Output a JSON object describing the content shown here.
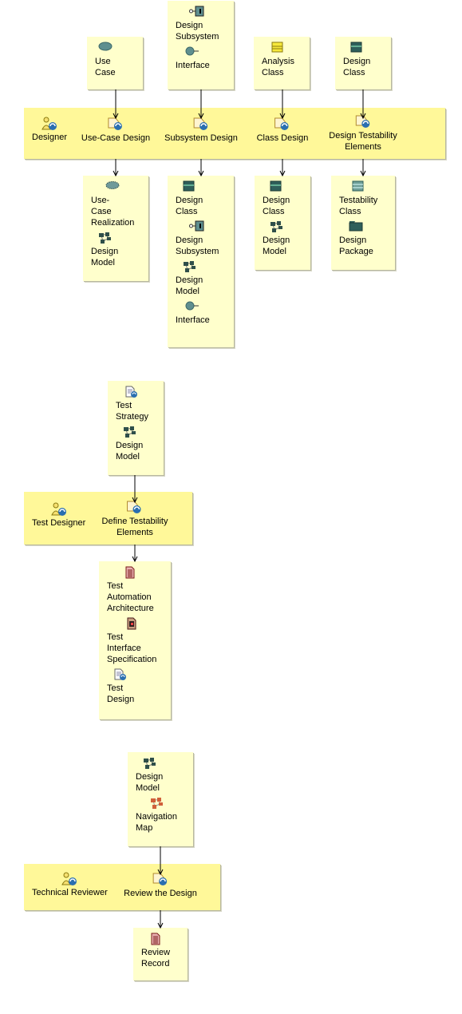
{
  "colors": {
    "artifact_fill": "#ffffcc",
    "band_fill": "#fff899"
  },
  "sections": [
    {
      "role": {
        "label": "Designer",
        "icon": "role-icon"
      },
      "activities": [
        {
          "label": "Use-Case Design",
          "icon": "activity-icon"
        },
        {
          "label": "Subsystem Design",
          "icon": "activity-icon"
        },
        {
          "label": "Class Design",
          "icon": "activity-icon"
        },
        {
          "label": "Design Testability\nElements",
          "icon": "activity-icon"
        }
      ],
      "inputs": [
        {
          "items": [
            {
              "label": "Use\nCase",
              "icon": "use-case-icon"
            }
          ]
        },
        {
          "items": [
            {
              "label": "Design\nSubsystem",
              "icon": "design-subsystem-icon"
            },
            {
              "label": "Interface",
              "icon": "interface-icon"
            }
          ]
        },
        {
          "items": [
            {
              "label": "Analysis\nClass",
              "icon": "analysis-class-icon"
            }
          ]
        },
        {
          "items": [
            {
              "label": "Design\nClass",
              "icon": "design-class-icon"
            }
          ]
        }
      ],
      "outputs": [
        {
          "items": [
            {
              "label": "Use-\nCase\nRealization",
              "icon": "use-case-realization-icon"
            },
            {
              "label": "Design\nModel",
              "icon": "design-model-icon"
            }
          ]
        },
        {
          "items": [
            {
              "label": "Design\nClass",
              "icon": "design-class-icon"
            },
            {
              "label": "Design\nSubsystem",
              "icon": "design-subsystem-icon"
            },
            {
              "label": "Design\nModel",
              "icon": "design-model-icon"
            },
            {
              "label": "Interface",
              "icon": "interface-icon"
            }
          ]
        },
        {
          "items": [
            {
              "label": "Design\nClass",
              "icon": "design-class-icon"
            },
            {
              "label": "Design\nModel",
              "icon": "design-model-icon"
            }
          ]
        },
        {
          "items": [
            {
              "label": "Testability\nClass",
              "icon": "testability-class-icon"
            },
            {
              "label": "Design\nPackage",
              "icon": "design-package-icon"
            }
          ]
        }
      ]
    },
    {
      "role": {
        "label": "Test Designer",
        "icon": "role-icon"
      },
      "activities": [
        {
          "label": "Define Testability\nElements",
          "icon": "activity-icon"
        }
      ],
      "inputs": [
        {
          "items": [
            {
              "label": "Test\nStrategy",
              "icon": "test-document-icon"
            },
            {
              "label": "Design\nModel",
              "icon": "design-model-icon"
            }
          ]
        }
      ],
      "outputs": [
        {
          "items": [
            {
              "label": "Test\nAutomation\nArchitecture",
              "icon": "document-icon"
            },
            {
              "label": "Test\nInterface\nSpecification",
              "icon": "specification-icon"
            },
            {
              "label": "Test\nDesign",
              "icon": "test-document-icon"
            }
          ]
        }
      ]
    },
    {
      "role": {
        "label": "Technical Reviewer",
        "icon": "role-icon"
      },
      "activities": [
        {
          "label": "Review the Design",
          "icon": "activity-icon"
        }
      ],
      "inputs": [
        {
          "items": [
            {
              "label": "Design\nModel",
              "icon": "design-model-icon"
            },
            {
              "label": "Navigation\nMap",
              "icon": "navigation-map-icon"
            }
          ]
        }
      ],
      "outputs": [
        {
          "items": [
            {
              "label": "Review\nRecord",
              "icon": "document-icon"
            }
          ]
        }
      ]
    }
  ]
}
